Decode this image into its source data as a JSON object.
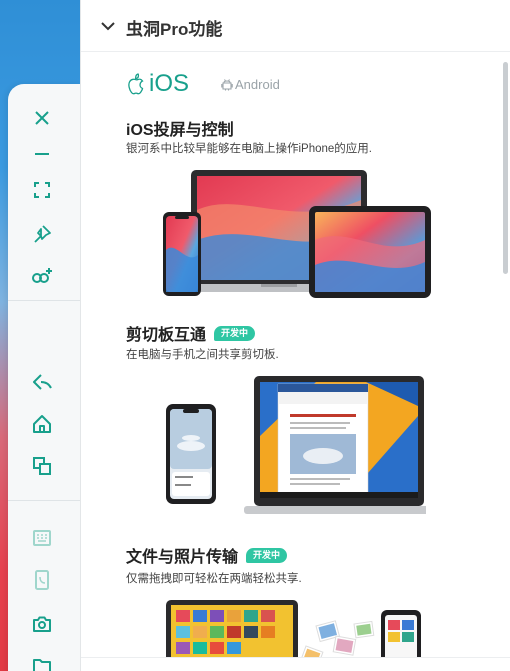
{
  "panel": {
    "title": "虫洞Pro功能"
  },
  "platforms": {
    "ios_label": "iOS",
    "android_label": "Android"
  },
  "sections": [
    {
      "title": "iOS投屏与控制",
      "description": "银河系中比较早能够在电脑上操作iPhone的应用."
    },
    {
      "title": "剪切板互通",
      "badge": "开发中",
      "description": "在电脑与手机之间共享剪切板."
    },
    {
      "title": "文件与照片传输",
      "badge": "开发中",
      "description": "仅需拖拽即可轻松在两端轻松共享."
    }
  ],
  "toolbar": {
    "icons": [
      "close-icon",
      "minimize-icon",
      "fullscreen-icon",
      "pin-icon",
      "link-add-icon",
      "back-icon",
      "home-icon",
      "multitask-icon",
      "keyboard-icon",
      "phone-icon",
      "camera-icon",
      "folder-icon"
    ]
  },
  "colors": {
    "accent": "#18a08c",
    "badge": "#2fc6a3"
  }
}
